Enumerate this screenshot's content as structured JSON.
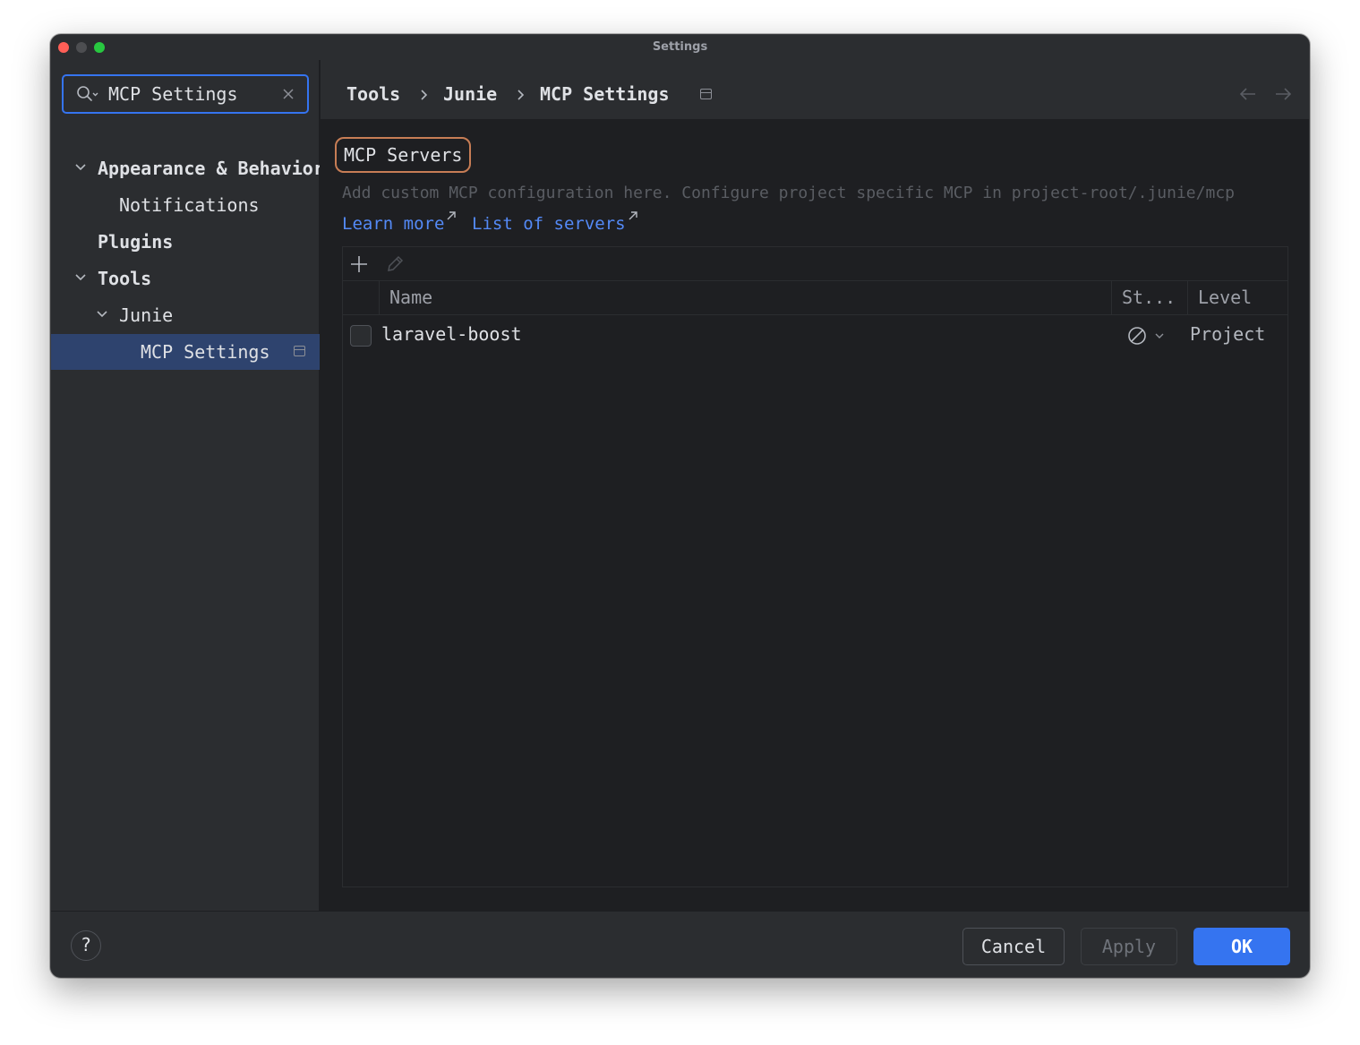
{
  "window": {
    "title": "Settings"
  },
  "search": {
    "value": "MCP Settings"
  },
  "sidebar": {
    "items": [
      {
        "label": "Appearance & Behavior",
        "expanded": true
      },
      {
        "label": "Notifications"
      },
      {
        "label": "Plugins"
      },
      {
        "label": "Tools",
        "expanded": true
      },
      {
        "label": "Junie",
        "expanded": true
      },
      {
        "label": "MCP Settings",
        "selected": true
      }
    ]
  },
  "breadcrumb": {
    "items": [
      "Tools",
      "Junie",
      "MCP Settings"
    ]
  },
  "section": {
    "title": "MCP Servers",
    "description": "Add custom MCP configuration here. Configure project specific MCP in project-root/.junie/mcp",
    "links": [
      "Learn more",
      "List of servers"
    ]
  },
  "table": {
    "columns": [
      "Name",
      "St...",
      "Level"
    ],
    "rows": [
      {
        "name": "laravel-boost",
        "status": "disabled",
        "level": "Project",
        "checked": false
      }
    ]
  },
  "footer": {
    "help": "?",
    "cancel": "Cancel",
    "apply": "Apply",
    "ok": "OK"
  },
  "colors": {
    "accent": "#3574f0",
    "link": "#548af7",
    "selection": "#2e436e",
    "group_outline": "#c77d55"
  }
}
